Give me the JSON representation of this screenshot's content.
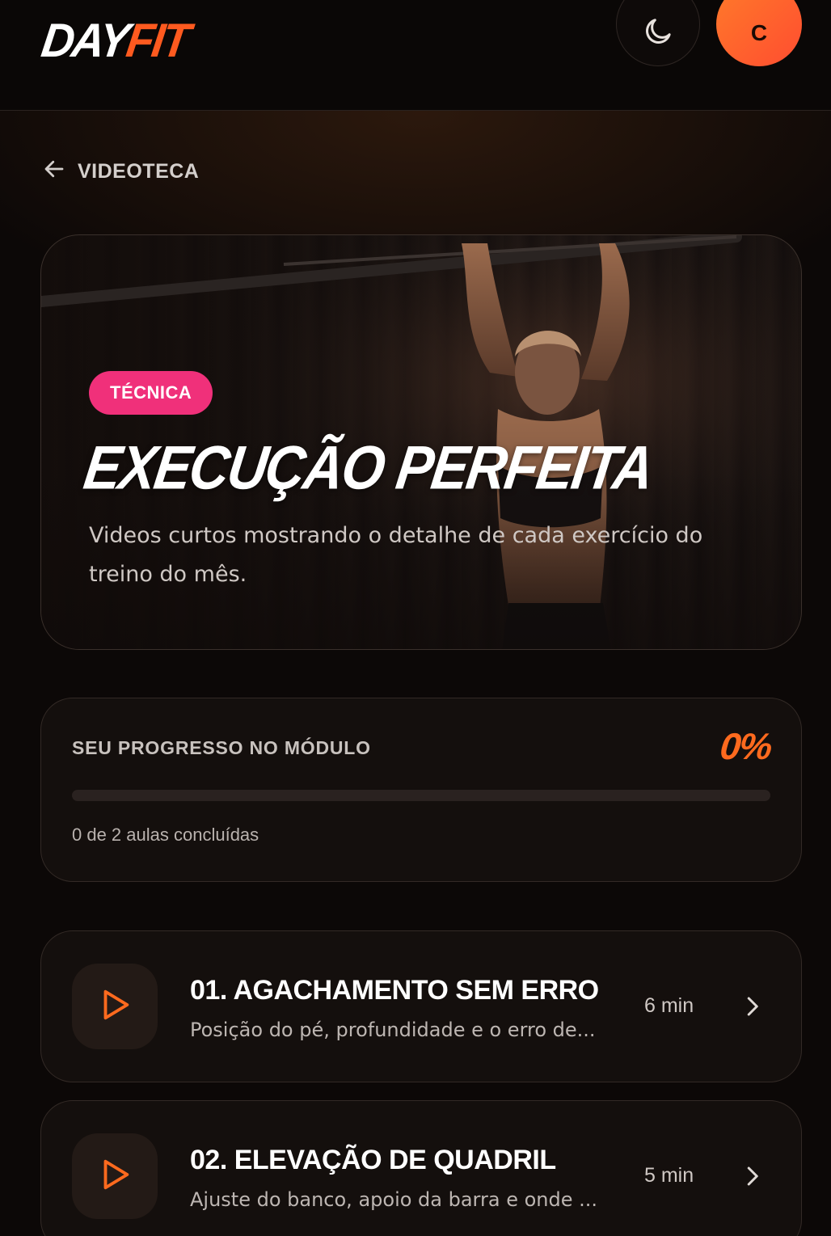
{
  "header": {
    "logo_day": "DAY",
    "logo_fit": "FIT",
    "avatar_initial": "C",
    "theme_icon": "moon-icon"
  },
  "nav": {
    "back_label": "VIDEOTECA",
    "back_icon": "arrow-left-icon"
  },
  "hero": {
    "badge": "TÉCNICA",
    "title": "EXECUÇÃO PERFEITA",
    "description": "Videos curtos mostrando o detalhe de cada exercício do treino do mês."
  },
  "progress": {
    "label": "SEU PROGRESSO NO MÓDULO",
    "percent_text": "0%",
    "fraction": 0,
    "summary": "0 de 2 aulas concluídas"
  },
  "lessons": [
    {
      "title": "01. AGACHAMENTO SEM ERRO",
      "description": "Posição do pé, profundidade e o erro de...",
      "duration": "6 min",
      "icon": "play-icon"
    },
    {
      "title": "02. ELEVAÇÃO DE QUADRIL",
      "description": "Ajuste do banco, apoio da barra e onde ...",
      "duration": "5 min",
      "icon": "play-icon"
    }
  ],
  "colors": {
    "accent": "#ff6a1e",
    "badge": "#f0307a",
    "background": "#0c0807",
    "card": "#140f0d"
  }
}
